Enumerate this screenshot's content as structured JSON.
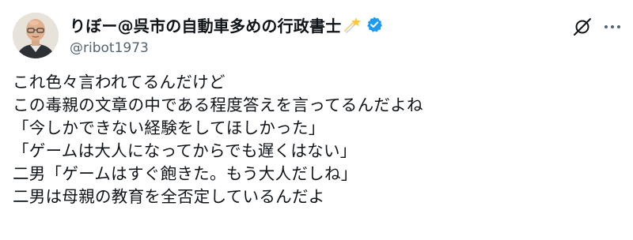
{
  "post": {
    "author": {
      "display_name": "りぼー@呉市の自動車多めの行政書士",
      "handle": "@ribot1973",
      "name_emoji": "shooting-star-emoji",
      "verified_badge": "verified-badge-icon",
      "avatar": "avatar"
    },
    "actions": {
      "grok_icon": "grok-icon",
      "more_icon": "more-options-icon"
    },
    "lines": [
      "これ色々言われてるんだけど",
      "この毒親の文章の中である程度答えを言ってるんだよね",
      "「今しかできない経験をしてほしかった」",
      "「ゲームは大人になってからでも遅くはない」",
      "二男「ゲームはすぐ飽きた。もう大人だしね」",
      "二男は母親の教育を全否定しているんだよ"
    ],
    "colors": {
      "verified": "#1d9bf0",
      "secondary_text": "#536471",
      "text": "#0f1419"
    }
  }
}
